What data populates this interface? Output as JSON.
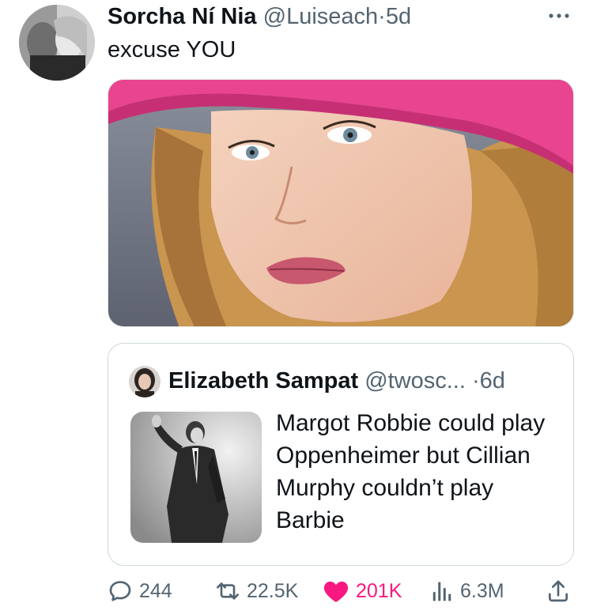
{
  "tweet": {
    "display_name": "Sorcha Ní Nia",
    "handle": "@Luiseach",
    "separator": "·",
    "time": "5d",
    "text": "excuse YOU",
    "more_icon": "more-horizontal-icon"
  },
  "quote": {
    "display_name": "Elizabeth Sampat",
    "handle": "@twosc...",
    "separator": "·",
    "time": "6d",
    "text": "Margot Robbie could play Oppenheimer but Cillian Murphy couldn’t play Barbie"
  },
  "actions": {
    "replies": "244",
    "retweets": "22.5K",
    "likes": "201K",
    "views": "6.3M",
    "reply_icon": "reply-bubble-icon",
    "retweet_icon": "retweet-icon",
    "like_icon": "heart-icon",
    "views_icon": "views-bar-chart-icon",
    "share_icon": "share-upload-icon"
  },
  "colors": {
    "text_primary": "#0f1419",
    "text_secondary": "#536471",
    "like_pink": "#f91880",
    "card_border": "#cfd9de"
  }
}
